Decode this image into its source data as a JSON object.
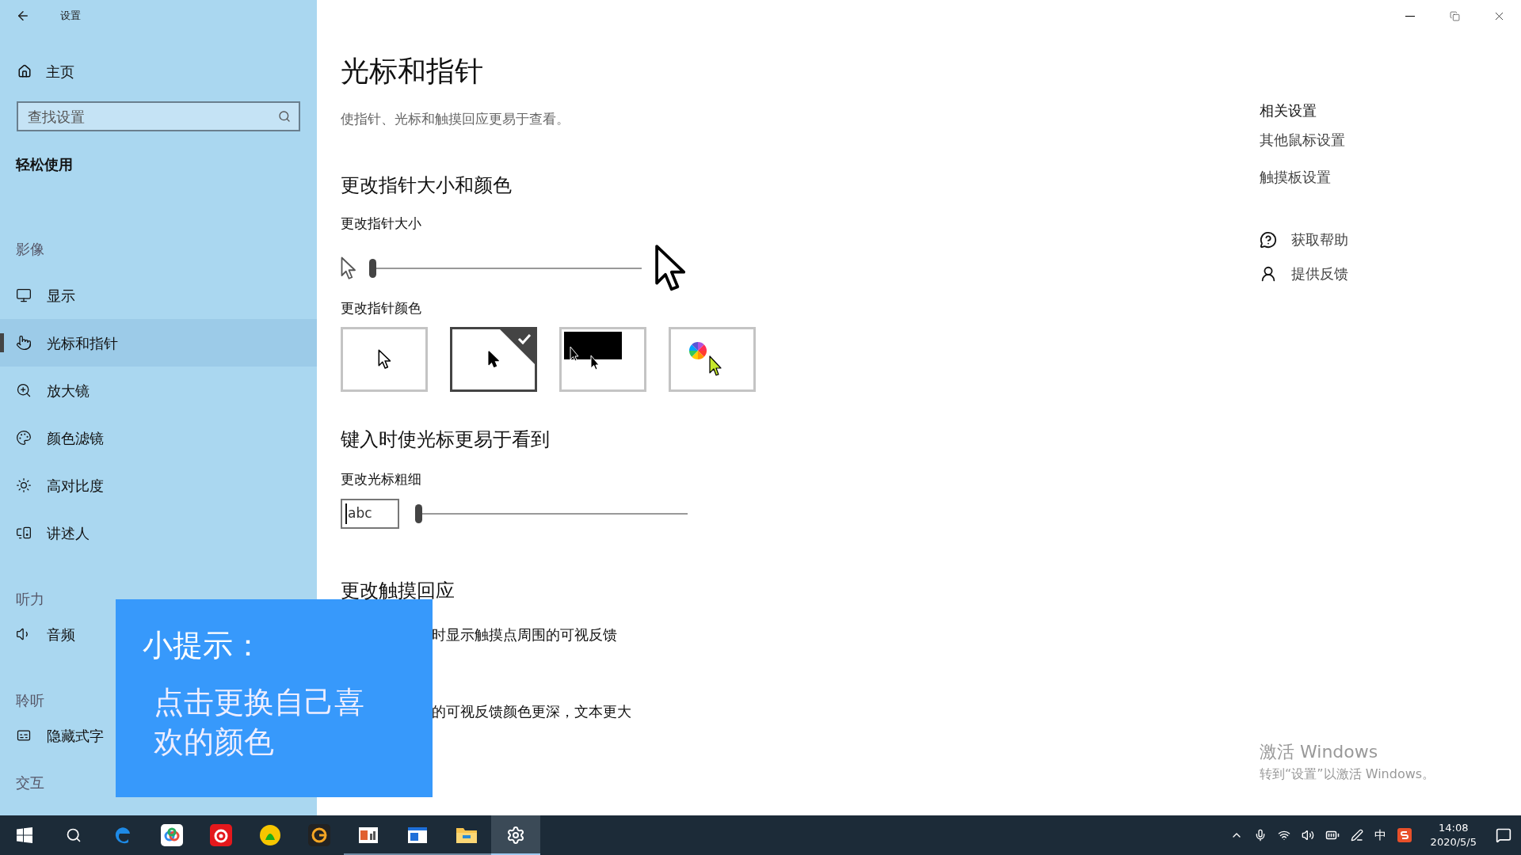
{
  "window": {
    "title": "设置"
  },
  "sidebar": {
    "home": "主页",
    "search": {
      "placeholder": "查找设置"
    },
    "category": "轻松使用",
    "groups": [
      {
        "heading": "影像",
        "items": [
          {
            "label": "显示",
            "kind": "monitor",
            "selected": false
          },
          {
            "label": "光标和指针",
            "kind": "pointer",
            "selected": true
          },
          {
            "label": "放大镜",
            "kind": "zoom",
            "selected": false
          },
          {
            "label": "颜色滤镜",
            "kind": "palette",
            "selected": false
          },
          {
            "label": "高对比度",
            "kind": "sun",
            "selected": false
          },
          {
            "label": "讲述人",
            "kind": "narrator",
            "selected": false
          }
        ]
      },
      {
        "heading": "听力",
        "items": [
          {
            "label": "音频",
            "kind": "audio",
            "selected": false
          }
        ]
      },
      {
        "heading": "聆听",
        "items": [
          {
            "label": "隐藏式字",
            "kind": "cc",
            "selected": false
          }
        ]
      },
      {
        "heading": "交互"
      }
    ]
  },
  "page": {
    "title": "光标和指针",
    "description": "使指针、光标和触摸回应更易于查看。",
    "pointer_section": {
      "heading": "更改指针大小和颜色",
      "size_label": "更改指针大小",
      "size_slider": {
        "level": 0
      },
      "color_label": "更改指针颜色",
      "color_options": [
        {
          "kind": "white",
          "selected": false
        },
        {
          "kind": "black",
          "selected": true
        },
        {
          "kind": "inverted",
          "selected": false
        },
        {
          "kind": "custom",
          "selected": false
        }
      ]
    },
    "cursor_section": {
      "heading": "键入时使光标更易于看到",
      "thickness_label": "更改光标粗细",
      "preview": "abc",
      "thickness_slider": {
        "level": 0
      }
    },
    "touch_section": {
      "heading": "更改触摸回应",
      "lines": [
        "时显示触摸点周围的可视反馈",
        "的可视反馈颜色更深，文本更大"
      ]
    }
  },
  "related": {
    "heading": "相关设置",
    "links": [
      "其他鼠标设置",
      "触摸板设置"
    ],
    "help": [
      {
        "kind": "help",
        "label": "获取帮助"
      },
      {
        "kind": "feedback",
        "label": "提供反馈"
      }
    ]
  },
  "activation": {
    "title": "激活 Windows",
    "text": "转到“设置”以激活 Windows。"
  },
  "tip": {
    "title": "小提示：",
    "text": "点击更换自己喜欢的颜色"
  },
  "taskbar": {
    "apps": [
      {
        "kind": "start",
        "running": false,
        "selected": false
      },
      {
        "kind": "search",
        "running": false,
        "selected": false
      },
      {
        "kind": "edge",
        "running": false,
        "selected": false
      },
      {
        "kind": "cloud",
        "running": false,
        "selected": false
      },
      {
        "kind": "netease",
        "running": false,
        "selected": false
      },
      {
        "kind": "music",
        "running": false,
        "selected": false
      },
      {
        "kind": "orange",
        "running": false,
        "selected": false
      },
      {
        "kind": "slides",
        "running": true,
        "selected": false
      },
      {
        "kind": "window",
        "running": true,
        "selected": false
      },
      {
        "kind": "folder",
        "running": true,
        "selected": false
      },
      {
        "kind": "settings",
        "running": true,
        "selected": true
      }
    ],
    "ime": "中",
    "time": "14:08",
    "date": "2020/5/5"
  }
}
